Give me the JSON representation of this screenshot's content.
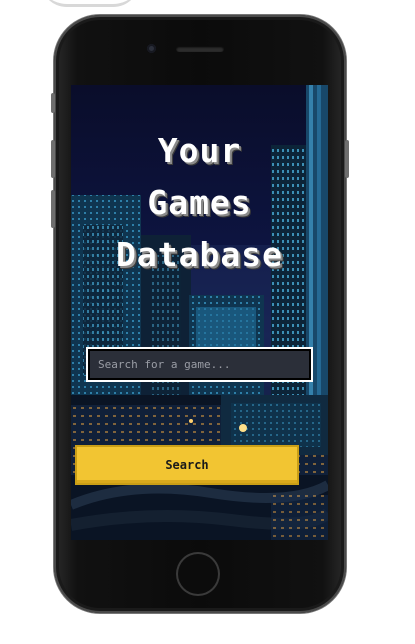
{
  "hero": {
    "title_lines": [
      "Your",
      "Games",
      "Database"
    ]
  },
  "search": {
    "placeholder": "Search for a game...",
    "value": ""
  },
  "actions": {
    "search_label": "Search"
  },
  "colors": {
    "button": "#f2c532",
    "input_bg": "#2b2f39",
    "sky": "#0d1440"
  }
}
